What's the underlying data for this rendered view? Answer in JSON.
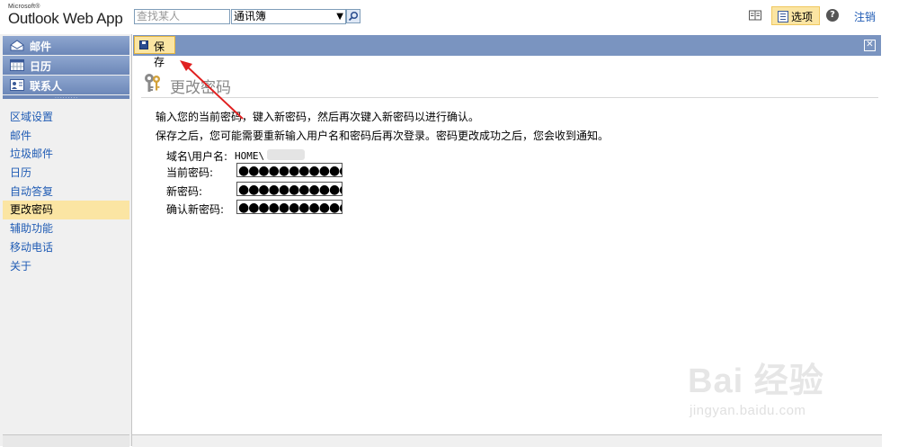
{
  "app": {
    "brand_vendor": "Microsoft®",
    "brand_name": "Outlook Web App"
  },
  "header": {
    "search_placeholder": "查找某人",
    "search_scope": "通讯簿",
    "options_label": "选项",
    "help_label": "?",
    "logout_label": "注销"
  },
  "sidebar": {
    "modules": [
      {
        "label": "邮件",
        "icon": "mail-icon"
      },
      {
        "label": "日历",
        "icon": "calendar-icon"
      },
      {
        "label": "联系人",
        "icon": "contacts-icon"
      }
    ],
    "items": [
      {
        "label": "区域设置"
      },
      {
        "label": "邮件"
      },
      {
        "label": "垃圾邮件"
      },
      {
        "label": "日历"
      },
      {
        "label": "自动答复"
      },
      {
        "label": "更改密码",
        "selected": true
      },
      {
        "label": "辅助功能"
      },
      {
        "label": "移动电话"
      },
      {
        "label": "关于"
      }
    ]
  },
  "toolbar": {
    "save_label": "保存",
    "close_label": "✕"
  },
  "content": {
    "title": "更改密码",
    "instruction_1": "输入您的当前密码，键入新密码，然后再次键入新密码以进行确认。",
    "instruction_2": "保存之后，您可能需要重新输入用户名和密码后再次登录。密码更改成功之后，您会收到通知。",
    "form": {
      "domain_user_label": "域名\\用户名:",
      "domain_user_value": "HOME\\",
      "current_password_label": "当前密码:",
      "current_password_value": "●●●●●●●●●●●",
      "new_password_label": "新密码:",
      "new_password_value": "●●●●●●●●●●●",
      "confirm_password_label": "确认新密码:",
      "confirm_password_value": "●●●●●●●●●●●"
    }
  },
  "watermark": {
    "main": "Bai 经验",
    "sub": "jingyan.baidu.com"
  },
  "colors": {
    "accent_nav": "#7a94c0",
    "selected_bg": "#fbe5a3",
    "link": "#1f5bb4",
    "annotation_arrow": "#e02020"
  }
}
